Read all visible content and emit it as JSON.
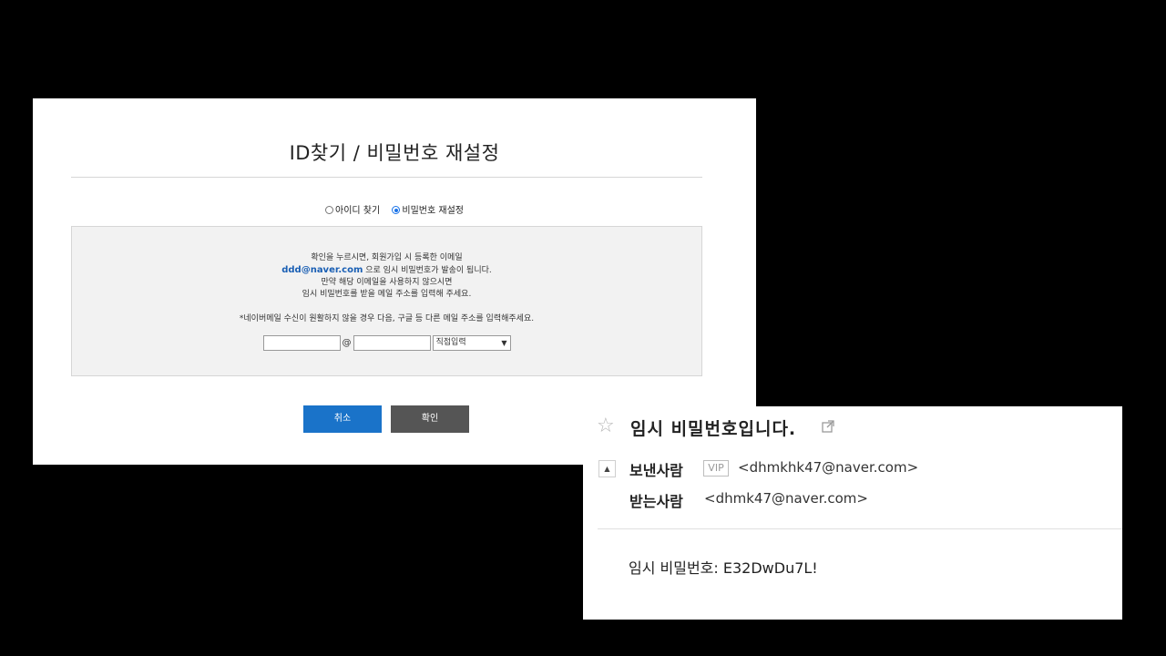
{
  "form": {
    "title": "ID찾기 / 비밀번호 재설정",
    "radios": {
      "find_id_label": "아이디 찾기",
      "reset_password_label": "비밀번호 재설정",
      "selected": "reset_password"
    },
    "info": {
      "line1": "확인을 누르시면, 회원가입 시 등록한 이메일",
      "email": "ddd@naver.com",
      "line2_suffix": " 으로 임시 비밀번호가 발송이 됩니다.",
      "line3": "만약 해당 이메일을 사용하지 않으시면",
      "line4": "임시 비밀번호를 받을 메일 주소를 입력해 주세요.",
      "note": "*네이버메일 수신이 원활하지 않을 경우 다음, 구글 등 다른 메일 주소를 입력해주세요."
    },
    "email_input": {
      "local_value": "",
      "at": "@",
      "domain_value": "",
      "domain_select_selected": "직접입력"
    },
    "buttons": {
      "cancel_label": "취소",
      "confirm_label": "확인"
    },
    "colors": {
      "cancel_bg": "#1a73c9",
      "confirm_bg": "#555555"
    }
  },
  "mail": {
    "subject": "임시 비밀번호입니다.",
    "from_label": "보낸사람",
    "vip_badge": "VIP",
    "from_address": "<dhmkhk47@naver.com>",
    "to_label": "받는사람",
    "to_address": "<dhmk47@naver.com>",
    "body": "임시 비밀번호: E32DwDu7L!",
    "icons": {
      "star": "star-icon",
      "popout": "external-link-icon",
      "toggle": "collapse-up-icon"
    }
  }
}
